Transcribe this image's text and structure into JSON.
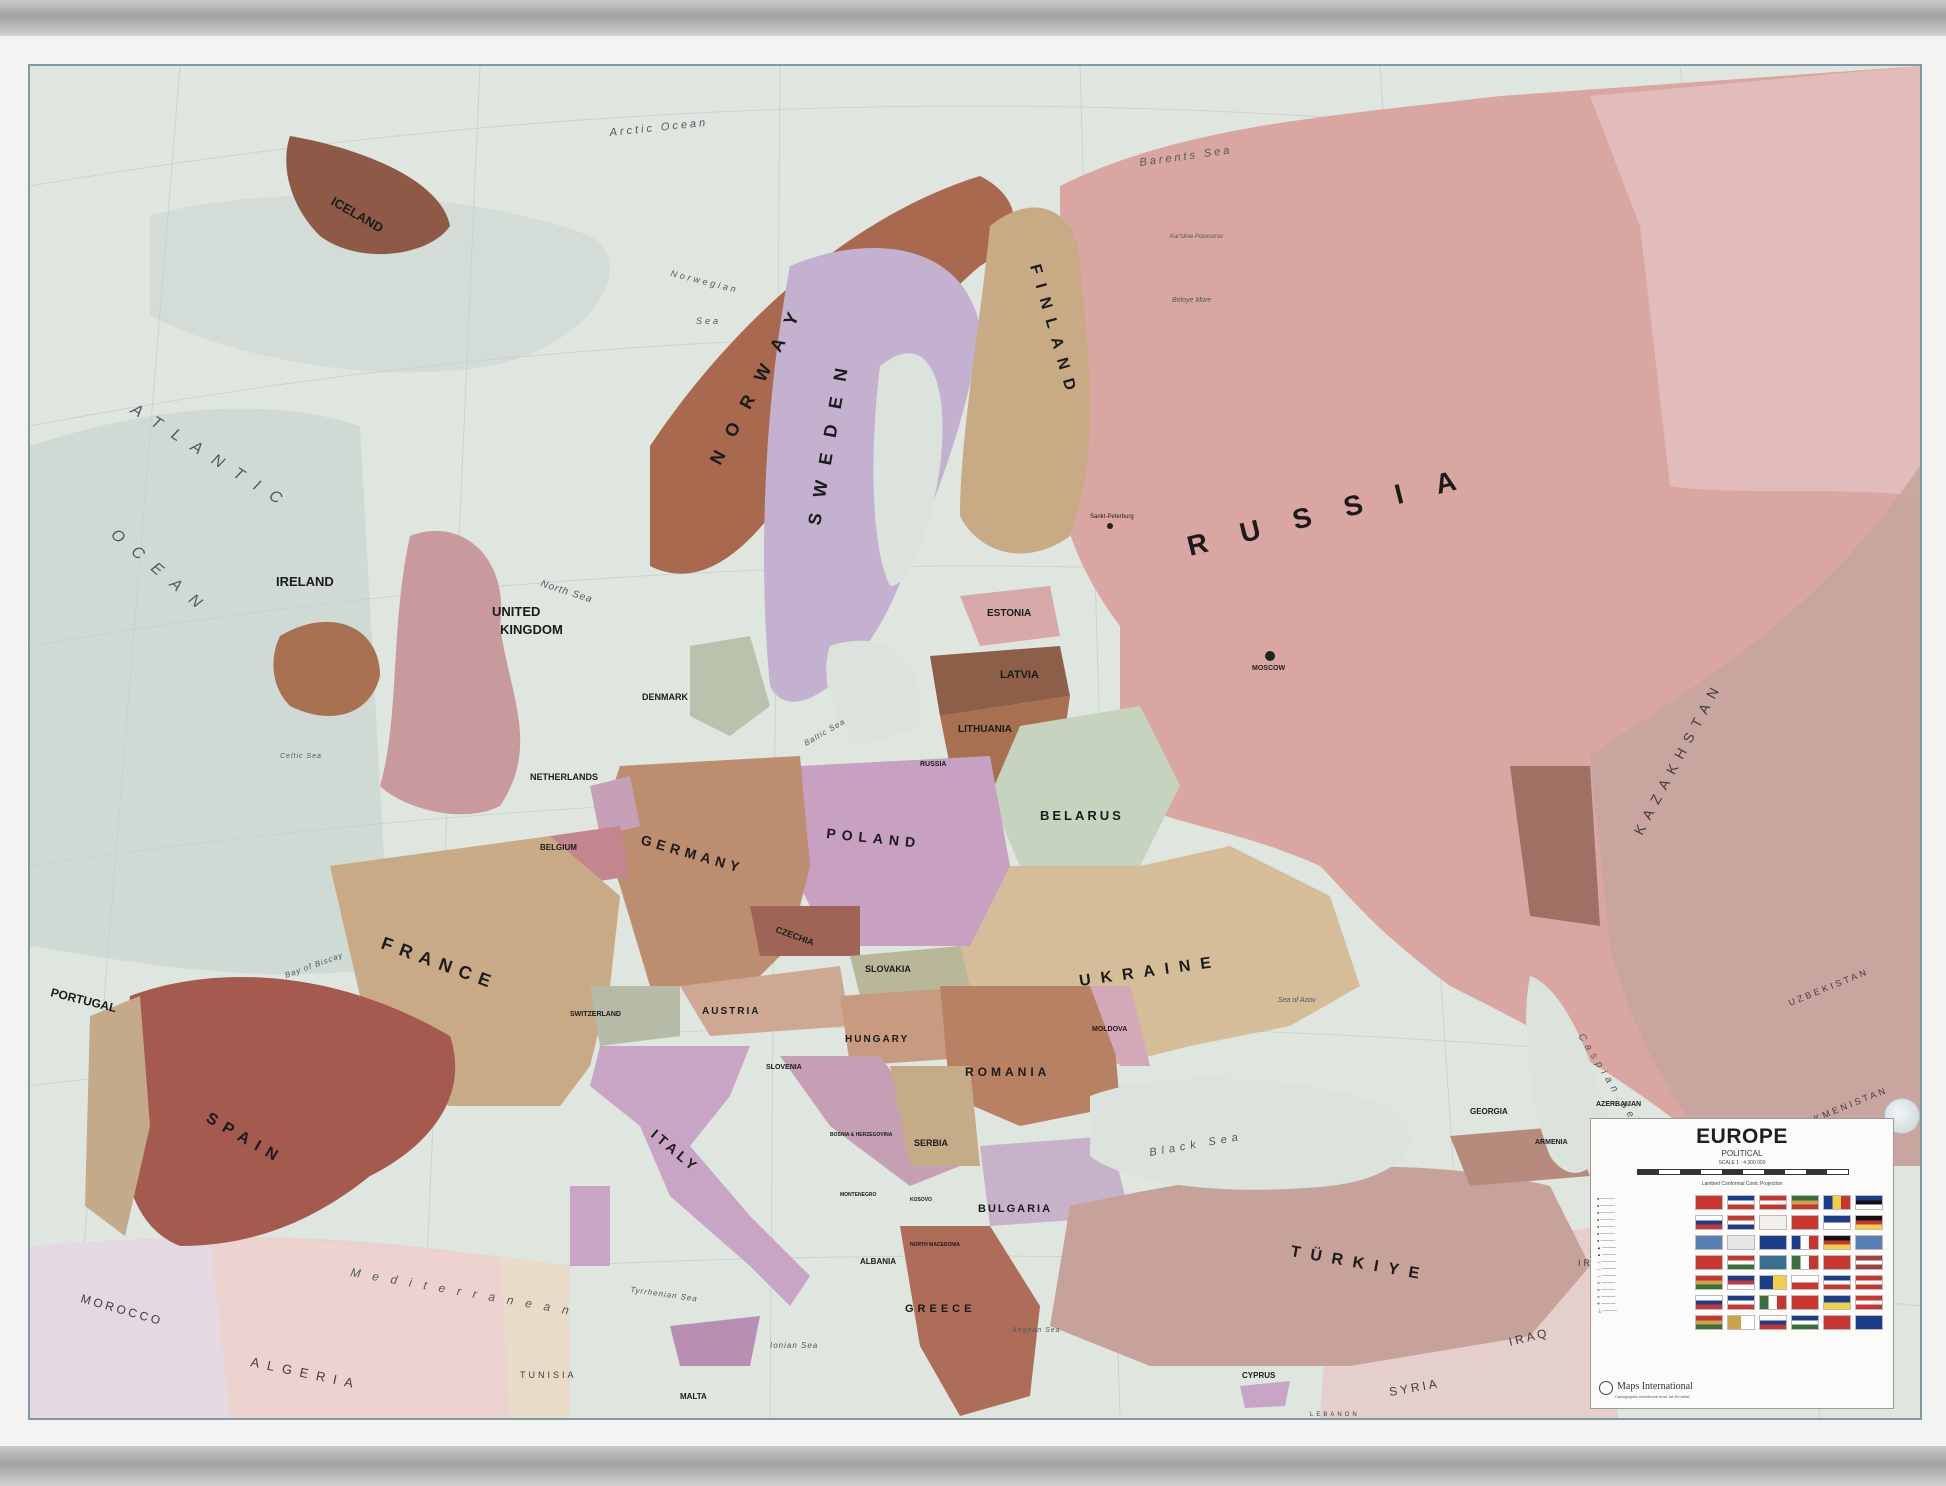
{
  "map": {
    "title": "EUROPE",
    "subtitle": "POLITICAL",
    "scale": "SCALE 1 : 4 300 000",
    "projection": "Lambert Conformal Conic Projection",
    "publisher": "Maps International",
    "publisher_sub": "Cartographic excellence from 1st Ed Artist",
    "colors": {
      "sea": "#dfe5df",
      "russia": "#d9a6a2",
      "spain": "#a55a4f",
      "france": "#c8aa86",
      "norway": "#a9694f",
      "sweden": "#c3b1cf",
      "poland": "#c7a0c2",
      "belarus": "#c6d4bf",
      "ukraine": "#d4bd98",
      "turkiye": "#c6a29b",
      "frame": "#f2f3f2"
    },
    "countries": {
      "iceland": "ICELAND",
      "ireland": "IRELAND",
      "uk_1": "UNITED",
      "uk_2": "KINGDOM",
      "norway": "NORWAY",
      "sweden": "SWEDEN",
      "finland": "FINLAND",
      "russia": "RUSSIA",
      "estonia": "ESTONIA",
      "latvia": "LATVIA",
      "lithuania": "LITHUANIA",
      "russia_small": "RUSSIA",
      "belarus": "BELARUS",
      "ukraine": "UKRAINE",
      "poland": "POLAND",
      "germany": "GERMANY",
      "denmark": "DENMARK",
      "netherlands": "NETHERLANDS",
      "belgium": "BELGIUM",
      "france": "FRANCE",
      "spain": "SPAIN",
      "portugal": "PORTUGAL",
      "switzerland": "SWITZERLAND",
      "austria": "AUSTRIA",
      "czechia": "CZECHIA",
      "slovakia": "SLOVAKIA",
      "hungary": "HUNGARY",
      "romania": "ROMANIA",
      "moldova": "MOLDOVA",
      "slovenia": "SLOVENIA",
      "serbia": "SERBIA",
      "bulgaria": "BULGARIA",
      "bosnia": "BOSNIA & HERZEGOVINA",
      "montenegro": "MONTENEGRO",
      "kosovo": "KOSOVO",
      "north_macedonia": "NORTH MACEDONIA",
      "albania": "ALBANIA",
      "greece": "GREECE",
      "italy": "ITALY",
      "malta": "MALTA",
      "cyprus": "CYPRUS",
      "turkiye": "TÜRKIYE",
      "georgia": "GEORGIA",
      "armenia": "ARMENIA",
      "azerbaijan": "AZERBAIJAN",
      "kazakhstan": "KAZAKHSTAN",
      "uzbekistan": "UZBEKISTAN",
      "turkmenistan": "TURKMENISTAN",
      "iran": "IRAN",
      "iraq": "IRAQ",
      "syria": "SYRIA",
      "lebanon": "LEBANON",
      "morocco": "MOROCCO",
      "algeria": "ALGERIA",
      "tunisia": "TUNISIA"
    },
    "seas": {
      "arctic": "Arctic Ocean",
      "barents": "Barents Sea",
      "norwegian_1": "Norwegian",
      "norwegian_2": "Sea",
      "atlantic_1": "ATLANTIC",
      "atlantic_2": "OCEAN",
      "north_sea": "North Sea",
      "baltic": "Baltic Sea",
      "bay_biscay": "Bay of Biscay",
      "celtic": "Celtic Sea",
      "mediterranean": "Mediterranean",
      "tyrrhenian": "Tyrrhenian Sea",
      "ionian": "Ionian Sea",
      "aegean": "Aegean Sea",
      "black_sea": "Black Sea",
      "caspian": "Caspian Sea",
      "azov": "Sea of Azov",
      "beloye": "Beloye More",
      "kara": "Kar'skoe Poluostrov"
    },
    "cities": {
      "moscow": "MOSCOW",
      "st_petersburg": "Sankt-Peterburg"
    }
  }
}
